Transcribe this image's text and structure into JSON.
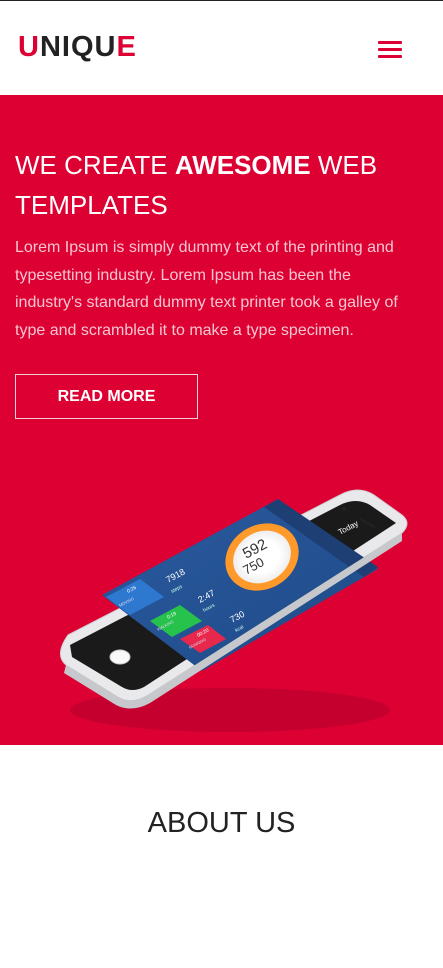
{
  "header": {
    "logo": {
      "u": "U",
      "middle": "NIQU",
      "e": "E"
    },
    "menu_icon": "hamburger-menu-icon"
  },
  "hero": {
    "title_pre": "WE CREATE ",
    "title_bold": "AWESOME",
    "title_post": " WEB TEMPLATES",
    "body": "Lorem Ipsum is simply dummy text of the printing and typesetting industry. Lorem Ipsum has been the industry's standard dummy text printer took a galley of type and scrambled it to make a type specimen.",
    "cta_label": "READ MORE",
    "background_color": "#dd0033"
  },
  "phone_screen": {
    "title": "Today",
    "ring_value": "592",
    "ring_sub": "750",
    "stats": [
      {
        "value": "7918",
        "label": "steps"
      },
      {
        "value": "2:47",
        "label": "hours"
      },
      {
        "value": "730",
        "label": "kcal"
      }
    ],
    "bars": [
      {
        "value": "0:26",
        "label": "MOVING"
      },
      {
        "value": "0:19",
        "label": "WALKING"
      },
      {
        "value": "00:20",
        "label": "RUNNING"
      }
    ]
  },
  "about": {
    "title": "ABOUT US"
  }
}
